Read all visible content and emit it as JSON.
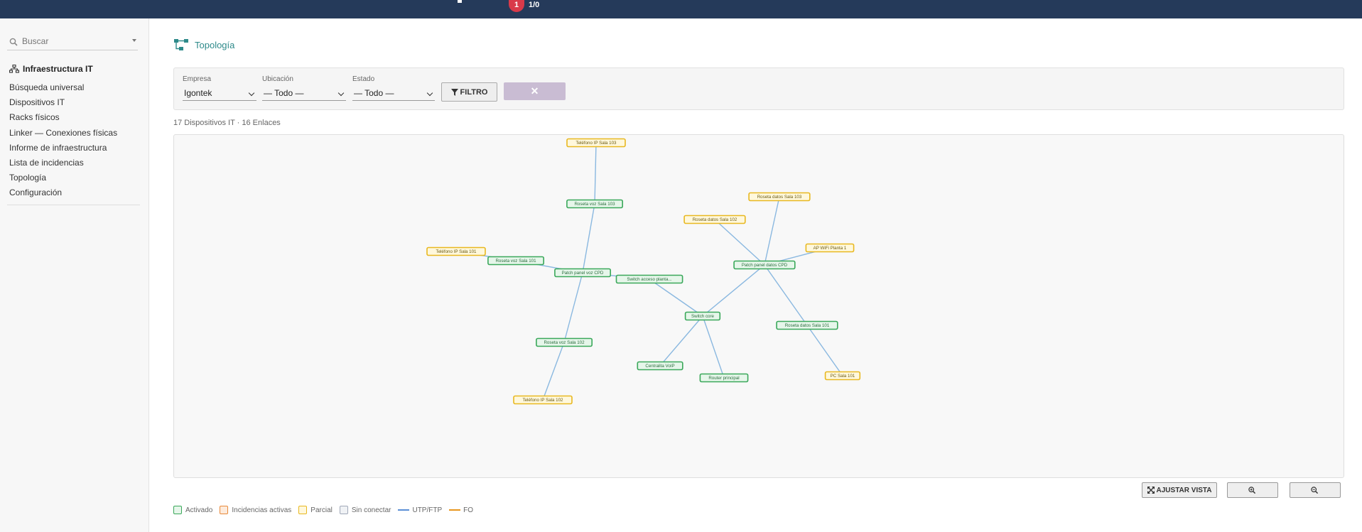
{
  "topbar": {
    "badge": "1",
    "ratio": "1/0"
  },
  "sidebar": {
    "search_placeholder": "Buscar",
    "heading": "Infraestructura IT",
    "items": [
      {
        "label": "Búsqueda universal"
      },
      {
        "label": "Dispositivos IT"
      },
      {
        "label": "Racks físicos"
      },
      {
        "label": "Linker — Conexiones físicas"
      },
      {
        "label": "Informe de infraestructura"
      },
      {
        "label": "Lista de incidencias"
      },
      {
        "label": "Topología"
      },
      {
        "label": "Configuración"
      }
    ]
  },
  "page": {
    "title": "Topología"
  },
  "filters": {
    "company": {
      "label": "Empresa",
      "value": "Igontek"
    },
    "location": {
      "label": "Ubicación",
      "value": "— Todo —"
    },
    "status": {
      "label": "Estado",
      "value": "— Todo —"
    },
    "filter_button": "FILTRO",
    "clear_button": "✕"
  },
  "summary": "17 Dispositivos IT · 16 Enlaces",
  "topology": {
    "nodes": [
      {
        "id": "tel103",
        "label": "Teléfono IP Sala 103",
        "status": "partial"
      },
      {
        "id": "rv103",
        "label": "Roseta voz Sala 103",
        "status": "active"
      },
      {
        "id": "tel101",
        "label": "Teléfono IP Sala 101",
        "status": "partial"
      },
      {
        "id": "rv101",
        "label": "Roseta voz Sala 101",
        "status": "active"
      },
      {
        "id": "ppv",
        "label": "Patch panel voz CPD",
        "status": "active"
      },
      {
        "id": "swa",
        "label": "Switch acceso planta...",
        "status": "active"
      },
      {
        "id": "rv102",
        "label": "Roseta voz Sala 102",
        "status": "active"
      },
      {
        "id": "tel102",
        "label": "Teléfono IP Sala 102",
        "status": "partial"
      },
      {
        "id": "swc",
        "label": "Switch core",
        "status": "active"
      },
      {
        "id": "pbx",
        "label": "Centralita VoIP",
        "status": "active"
      },
      {
        "id": "rtr",
        "label": "Router principal",
        "status": "active"
      },
      {
        "id": "rd102",
        "label": "Roseta datos Sala 102",
        "status": "partial"
      },
      {
        "id": "rd103",
        "label": "Roseta datos Sala 103",
        "status": "partial"
      },
      {
        "id": "ppd",
        "label": "Patch panel datos CPD",
        "status": "active"
      },
      {
        "id": "ap",
        "label": "AP WiFi Planta 1",
        "status": "partial"
      },
      {
        "id": "rd101",
        "label": "Roseta datos Sala 101",
        "status": "active"
      },
      {
        "id": "pc101",
        "label": "PC Sala 101",
        "status": "partial"
      }
    ],
    "links": [
      [
        "tel103",
        "rv103"
      ],
      [
        "rv103",
        "ppv"
      ],
      [
        "tel101",
        "rv101"
      ],
      [
        "rv101",
        "ppv"
      ],
      [
        "ppv",
        "rv102"
      ],
      [
        "rv102",
        "tel102"
      ],
      [
        "ppv",
        "swa"
      ],
      [
        "swa",
        "swc"
      ],
      [
        "swc",
        "pbx"
      ],
      [
        "swc",
        "rtr"
      ],
      [
        "swc",
        "ppd"
      ],
      [
        "ppd",
        "rd102"
      ],
      [
        "ppd",
        "rd103"
      ],
      [
        "ppd",
        "ap"
      ],
      [
        "ppd",
        "rd101"
      ],
      [
        "rd101",
        "pc101"
      ]
    ]
  },
  "controls": {
    "fit": "AJUSTAR VISTA"
  },
  "legend": {
    "active": "Activado",
    "incidents": "Incidencias activas",
    "partial": "Parcial",
    "disconnected": "Sin conectar",
    "utp": "UTP/FTP",
    "fo": "FO"
  },
  "colors": {
    "topbar": "#253a5a",
    "active_border": "#3aa85a",
    "active_fill": "#e6f6ea",
    "partial_border": "#e8b820",
    "partial_fill": "#fff8dc",
    "incidents_border": "#e88a3a",
    "disconnected_border": "#a0a8b8",
    "link_utp": "#8ab8e0",
    "link_fo": "#e8961e",
    "accent": "#2e8a8a"
  }
}
